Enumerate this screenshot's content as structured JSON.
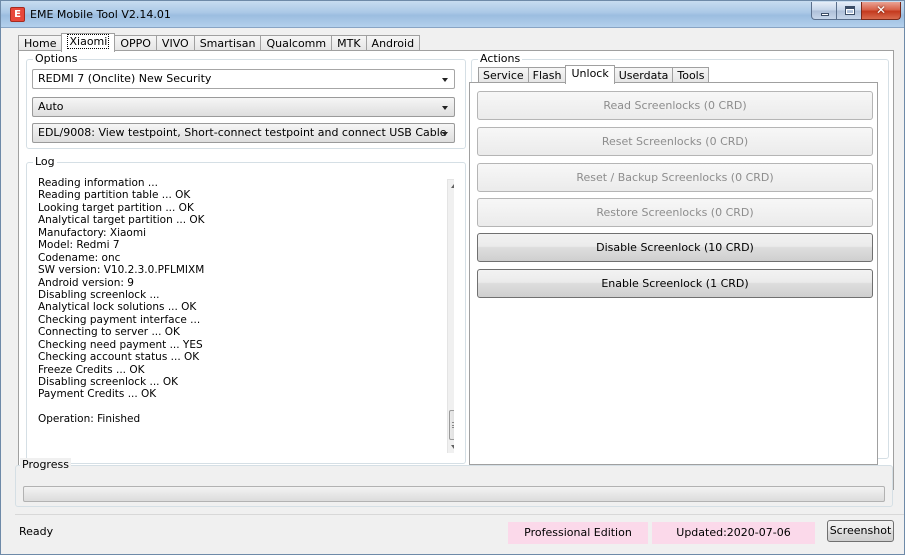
{
  "window": {
    "title": "EME Mobile Tool V2.14.01",
    "icon_letter": "E",
    "close_glyph": "✕"
  },
  "main_tabs": [
    {
      "label": "Home",
      "active": false
    },
    {
      "label": "Xiaomi",
      "active": true
    },
    {
      "label": "OPPO",
      "active": false
    },
    {
      "label": "VIVO",
      "active": false
    },
    {
      "label": "Smartisan",
      "active": false
    },
    {
      "label": "Qualcomm",
      "active": false
    },
    {
      "label": "MTK",
      "active": false
    },
    {
      "label": "Android",
      "active": false
    }
  ],
  "options": {
    "label": "Options",
    "model_select": "REDMI 7 (Onclite) New Security",
    "mode_select": "Auto",
    "connection_select": "EDL/9008: View testpoint, Short-connect testpoint and connect USB Cable"
  },
  "log": {
    "label": "Log",
    "lines": [
      "Reading information ...",
      "Reading partition table ... OK",
      "Looking target partition ... OK",
      "Analytical target partition ... OK",
      "Manufactory: Xiaomi",
      "Model: Redmi 7",
      "Codename: onc",
      "SW version: V10.2.3.0.PFLMIXM",
      "Android version: 9",
      "Disabling screenlock ...",
      "Analytical lock solutions ... OK",
      "Checking payment interface ...",
      "Connecting to server ... OK",
      "Checking need payment ... YES",
      "Checking account status ... OK",
      "Freeze Credits ... OK",
      "Disabling screenlock ... OK",
      "Payment Credits ... OK",
      "",
      "Operation: Finished"
    ]
  },
  "actions": {
    "label": "Actions",
    "tabs": [
      {
        "label": "Service",
        "active": false
      },
      {
        "label": "Flash",
        "active": false
      },
      {
        "label": "Unlock",
        "active": true
      },
      {
        "label": "Userdata",
        "active": false
      },
      {
        "label": "Tools",
        "active": false
      }
    ],
    "buttons": [
      {
        "label": "Read Screenlocks (0 CRD)",
        "enabled": false
      },
      {
        "label": "Reset Screenlocks (0 CRD)",
        "enabled": false
      },
      {
        "label": "Reset / Backup Screenlocks (0 CRD)",
        "enabled": false
      },
      {
        "label": "Restore Screenlocks (0 CRD)",
        "enabled": false
      },
      {
        "label": "Disable Screenlock (10 CRD)",
        "enabled": true
      },
      {
        "label": "Enable Screenlock (1 CRD)",
        "enabled": true
      }
    ]
  },
  "progress": {
    "label": "Progress",
    "value": 0,
    "fill_color": "#37c248"
  },
  "statusbar": {
    "status": "Ready",
    "edition": "Professional Edition",
    "updated": "Updated:2020-07-06",
    "screenshot_label": "Screenshot",
    "pill_color": "#fbd9ea"
  }
}
